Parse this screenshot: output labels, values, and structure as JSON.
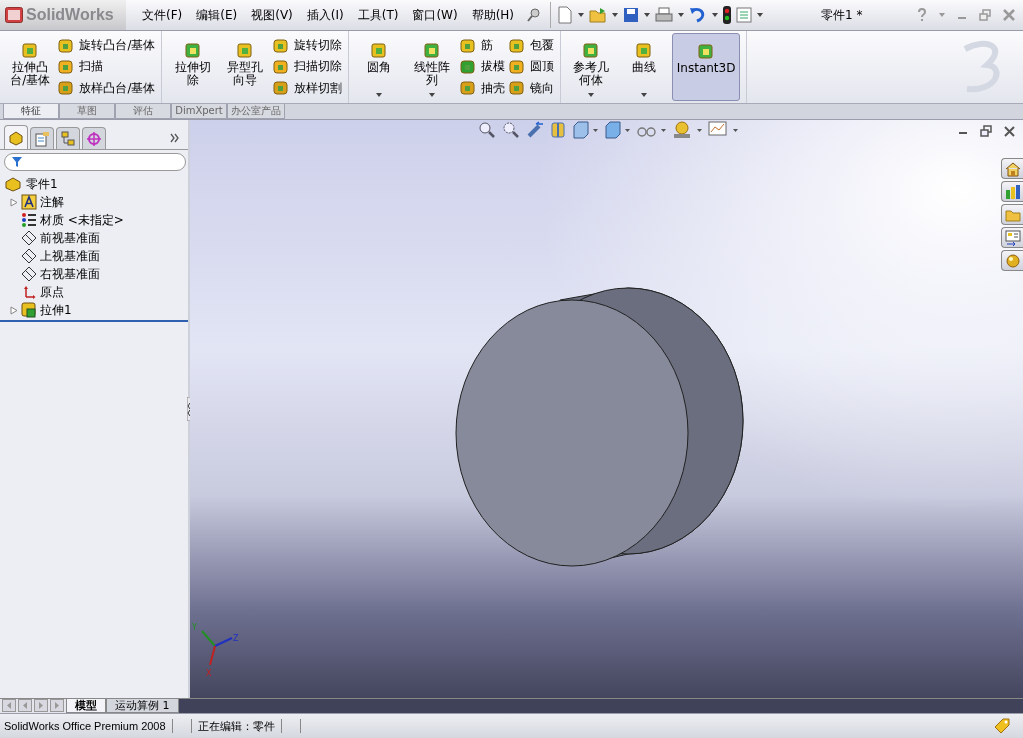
{
  "app": {
    "logo": "SolidWorks"
  },
  "menu": [
    "文件(F)",
    "编辑(E)",
    "视图(V)",
    "插入(I)",
    "工具(T)",
    "窗口(W)",
    "帮助(H)"
  ],
  "document_title": "零件1 *",
  "ribbon": {
    "groups": [
      [
        {
          "kind": "large",
          "label": "拉伸凸台/基体",
          "dropdown": false,
          "on": false
        },
        {
          "kind": "stack",
          "items": [
            "旋转凸台/基体",
            "扫描",
            "放样凸台/基体"
          ]
        }
      ],
      [
        {
          "kind": "large",
          "label": "拉伸切除",
          "dropdown": false,
          "on": false
        },
        {
          "kind": "large",
          "label": "异型孔向导",
          "dropdown": false,
          "on": false
        },
        {
          "kind": "stack",
          "items": [
            "旋转切除",
            "扫描切除",
            "放样切割"
          ]
        }
      ],
      [
        {
          "kind": "large",
          "label": "圆角",
          "dropdown": true,
          "on": false
        },
        {
          "kind": "large",
          "label": "线性阵列",
          "dropdown": true,
          "on": false
        },
        {
          "kind": "stack",
          "items": [
            "筋",
            "拔模",
            "抽壳"
          ]
        },
        {
          "kind": "stack",
          "items": [
            "包覆",
            "圆顶",
            "镜向"
          ]
        }
      ],
      [
        {
          "kind": "large",
          "label": "参考几何体",
          "dropdown": true,
          "on": false
        },
        {
          "kind": "large",
          "label": "曲线",
          "dropdown": true,
          "on": false
        },
        {
          "kind": "large",
          "label": "Instant3D",
          "dropdown": false,
          "on": true
        }
      ]
    ]
  },
  "ribbon_tabs": [
    {
      "label": "特征",
      "selected": true
    },
    {
      "label": "草图",
      "selected": false
    },
    {
      "label": "评估",
      "selected": false
    },
    {
      "label": "DimXpert",
      "selected": false
    },
    {
      "label": "办公室产品",
      "selected": false
    }
  ],
  "feature_tree": {
    "tabs": [
      {
        "selected": true
      },
      {
        "selected": false
      },
      {
        "selected": false
      },
      {
        "selected": false
      }
    ],
    "root": {
      "label": "零件1",
      "children": [
        {
          "label": "注解",
          "expandable": true
        },
        {
          "label": "材质 <未指定>",
          "expandable": false
        },
        {
          "label": "前视基准面",
          "expandable": false
        },
        {
          "label": "上视基准面",
          "expandable": false
        },
        {
          "label": "右视基准面",
          "expandable": false
        },
        {
          "label": "原点",
          "expandable": false
        },
        {
          "label": "拉伸1",
          "expandable": true
        }
      ]
    }
  },
  "triad": {
    "x": "X",
    "y": "Y",
    "z": "Z"
  },
  "bottom_tabs": [
    {
      "label": "模型",
      "selected": true
    },
    {
      "label": "运动算例 1",
      "selected": false
    }
  ],
  "status_bar": {
    "product": "SolidWorks Office Premium 2008",
    "mode": "正在编辑：零件"
  }
}
